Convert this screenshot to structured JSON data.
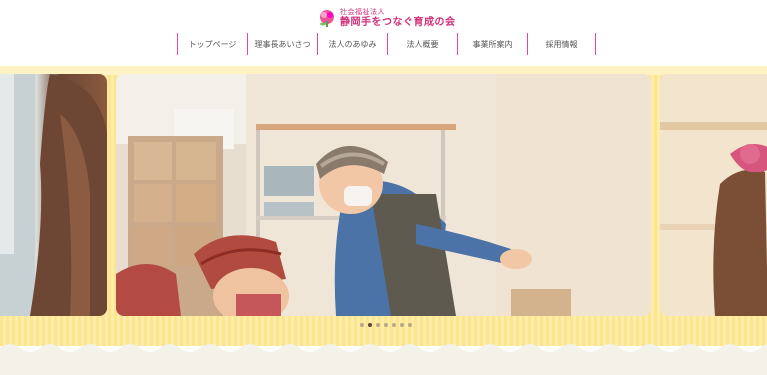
{
  "site": {
    "org_type": "社会福祉法人",
    "org_name": "静岡手をつなぐ育成の会"
  },
  "nav": {
    "items": [
      {
        "label": "トップページ"
      },
      {
        "label": "理事長あいさつ"
      },
      {
        "label": "法人のあゆみ"
      },
      {
        "label": "法人概要"
      },
      {
        "label": "事業所案内"
      },
      {
        "label": "採用情報"
      }
    ]
  },
  "slider": {
    "dot_count": 7,
    "active_index": 1
  },
  "colors": {
    "brand": "#d0307a",
    "nav_divider": "#e0489a",
    "band": "#fde48e"
  }
}
